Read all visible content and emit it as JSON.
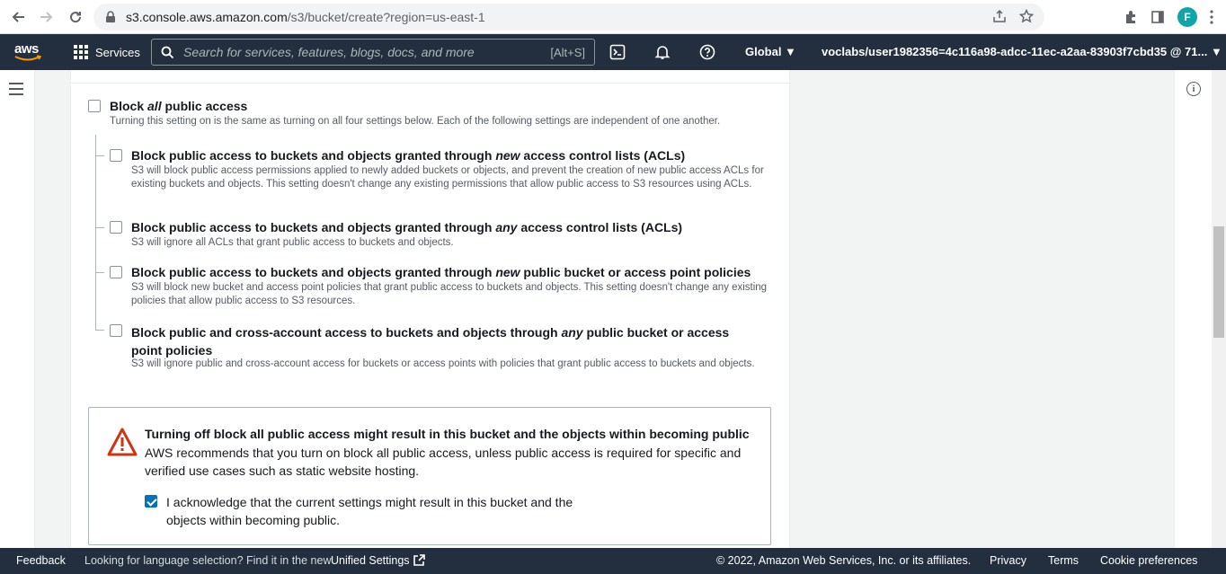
{
  "browser": {
    "url_host": "s3.console.aws.amazon.com",
    "url_path": "/s3/bucket/create?region=us-east-1",
    "profile_initial": "F"
  },
  "aws_nav": {
    "logo": "aws",
    "services_label": "Services",
    "search_placeholder": "Search for services, features, blogs, docs, and more",
    "search_shortcut": "[Alt+S]",
    "region_label": "Global ▼",
    "account_label": "voclabs/user1982356=4c116a98-adcc-11ec-a2aa-83903f7cbd35 @ 71... ▼"
  },
  "block_public_access": {
    "all": {
      "title_pre": "Block ",
      "title_em": "all",
      "title_post": " public access",
      "description": "Turning this setting on is the same as turning on all four settings below. Each of the following settings are independent of one another.",
      "checked": false
    },
    "options": [
      {
        "title_pre": "Block public access to buckets and objects granted through ",
        "title_em": "new",
        "title_post": " access control lists (ACLs)",
        "description": "S3 will block public access permissions applied to newly added buckets or objects, and prevent the creation of new public access ACLs for existing buckets and objects. This setting doesn't change any existing permissions that allow public access to S3 resources using ACLs.",
        "checked": false
      },
      {
        "title_pre": "Block public access to buckets and objects granted through ",
        "title_em": "any",
        "title_post": " access control lists (ACLs)",
        "description": "S3 will ignore all ACLs that grant public access to buckets and objects.",
        "checked": false
      },
      {
        "title_pre": "Block public access to buckets and objects granted through ",
        "title_em": "new",
        "title_post": " public bucket or access point policies",
        "description": "S3 will block new bucket and access point policies that grant public access to buckets and objects. This setting doesn't change any existing policies that allow public access to S3 resources.",
        "checked": false
      },
      {
        "title_pre": "Block public and cross-account access to buckets and objects through ",
        "title_em": "any",
        "title_post": " public bucket or access point policies",
        "description": "S3 will ignore public and cross-account access for buckets or access points with policies that grant public access to buckets and objects.",
        "checked": false
      }
    ]
  },
  "warning": {
    "title": "Turning off block all public access might result in this bucket and the objects within becoming public",
    "body": "AWS recommends that you turn on block all public access, unless public access is required for specific and verified use cases such as static website hosting.",
    "acknowledge_label": "I acknowledge that the current settings might result in this bucket and the objects within becoming public.",
    "acknowledge_checked": true
  },
  "footer": {
    "feedback": "Feedback",
    "language_message": "Looking for language selection? Find it in the new",
    "unified_settings": "Unified Settings",
    "copyright": "© 2022, Amazon Web Services, Inc. or its affiliates.",
    "privacy": "Privacy",
    "terms": "Terms",
    "cookie_preferences": "Cookie preferences"
  },
  "colors": {
    "aws_nav_bg": "#232f3e",
    "accent_blue": "#0073bb",
    "warning_red": "#d13212"
  }
}
